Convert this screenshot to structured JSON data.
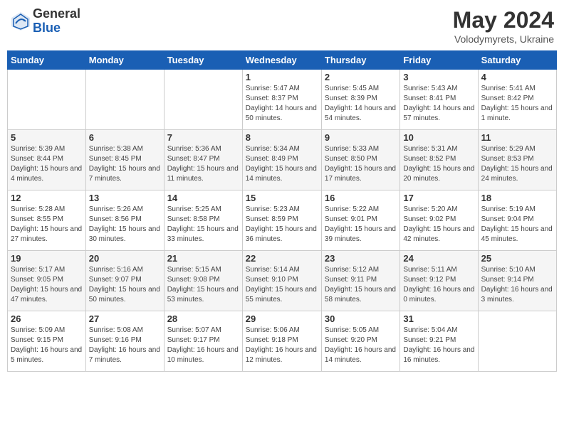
{
  "header": {
    "logo_general": "General",
    "logo_blue": "Blue",
    "month": "May 2024",
    "location": "Volodymyrets, Ukraine"
  },
  "weekdays": [
    "Sunday",
    "Monday",
    "Tuesday",
    "Wednesday",
    "Thursday",
    "Friday",
    "Saturday"
  ],
  "weeks": [
    [
      {
        "day": "",
        "info": ""
      },
      {
        "day": "",
        "info": ""
      },
      {
        "day": "",
        "info": ""
      },
      {
        "day": "1",
        "info": "Sunrise: 5:47 AM\nSunset: 8:37 PM\nDaylight: 14 hours\nand 50 minutes."
      },
      {
        "day": "2",
        "info": "Sunrise: 5:45 AM\nSunset: 8:39 PM\nDaylight: 14 hours\nand 54 minutes."
      },
      {
        "day": "3",
        "info": "Sunrise: 5:43 AM\nSunset: 8:41 PM\nDaylight: 14 hours\nand 57 minutes."
      },
      {
        "day": "4",
        "info": "Sunrise: 5:41 AM\nSunset: 8:42 PM\nDaylight: 15 hours\nand 1 minute."
      }
    ],
    [
      {
        "day": "5",
        "info": "Sunrise: 5:39 AM\nSunset: 8:44 PM\nDaylight: 15 hours\nand 4 minutes."
      },
      {
        "day": "6",
        "info": "Sunrise: 5:38 AM\nSunset: 8:45 PM\nDaylight: 15 hours\nand 7 minutes."
      },
      {
        "day": "7",
        "info": "Sunrise: 5:36 AM\nSunset: 8:47 PM\nDaylight: 15 hours\nand 11 minutes."
      },
      {
        "day": "8",
        "info": "Sunrise: 5:34 AM\nSunset: 8:49 PM\nDaylight: 15 hours\nand 14 minutes."
      },
      {
        "day": "9",
        "info": "Sunrise: 5:33 AM\nSunset: 8:50 PM\nDaylight: 15 hours\nand 17 minutes."
      },
      {
        "day": "10",
        "info": "Sunrise: 5:31 AM\nSunset: 8:52 PM\nDaylight: 15 hours\nand 20 minutes."
      },
      {
        "day": "11",
        "info": "Sunrise: 5:29 AM\nSunset: 8:53 PM\nDaylight: 15 hours\nand 24 minutes."
      }
    ],
    [
      {
        "day": "12",
        "info": "Sunrise: 5:28 AM\nSunset: 8:55 PM\nDaylight: 15 hours\nand 27 minutes."
      },
      {
        "day": "13",
        "info": "Sunrise: 5:26 AM\nSunset: 8:56 PM\nDaylight: 15 hours\nand 30 minutes."
      },
      {
        "day": "14",
        "info": "Sunrise: 5:25 AM\nSunset: 8:58 PM\nDaylight: 15 hours\nand 33 minutes."
      },
      {
        "day": "15",
        "info": "Sunrise: 5:23 AM\nSunset: 8:59 PM\nDaylight: 15 hours\nand 36 minutes."
      },
      {
        "day": "16",
        "info": "Sunrise: 5:22 AM\nSunset: 9:01 PM\nDaylight: 15 hours\nand 39 minutes."
      },
      {
        "day": "17",
        "info": "Sunrise: 5:20 AM\nSunset: 9:02 PM\nDaylight: 15 hours\nand 42 minutes."
      },
      {
        "day": "18",
        "info": "Sunrise: 5:19 AM\nSunset: 9:04 PM\nDaylight: 15 hours\nand 45 minutes."
      }
    ],
    [
      {
        "day": "19",
        "info": "Sunrise: 5:17 AM\nSunset: 9:05 PM\nDaylight: 15 hours\nand 47 minutes."
      },
      {
        "day": "20",
        "info": "Sunrise: 5:16 AM\nSunset: 9:07 PM\nDaylight: 15 hours\nand 50 minutes."
      },
      {
        "day": "21",
        "info": "Sunrise: 5:15 AM\nSunset: 9:08 PM\nDaylight: 15 hours\nand 53 minutes."
      },
      {
        "day": "22",
        "info": "Sunrise: 5:14 AM\nSunset: 9:10 PM\nDaylight: 15 hours\nand 55 minutes."
      },
      {
        "day": "23",
        "info": "Sunrise: 5:12 AM\nSunset: 9:11 PM\nDaylight: 15 hours\nand 58 minutes."
      },
      {
        "day": "24",
        "info": "Sunrise: 5:11 AM\nSunset: 9:12 PM\nDaylight: 16 hours\nand 0 minutes."
      },
      {
        "day": "25",
        "info": "Sunrise: 5:10 AM\nSunset: 9:14 PM\nDaylight: 16 hours\nand 3 minutes."
      }
    ],
    [
      {
        "day": "26",
        "info": "Sunrise: 5:09 AM\nSunset: 9:15 PM\nDaylight: 16 hours\nand 5 minutes."
      },
      {
        "day": "27",
        "info": "Sunrise: 5:08 AM\nSunset: 9:16 PM\nDaylight: 16 hours\nand 7 minutes."
      },
      {
        "day": "28",
        "info": "Sunrise: 5:07 AM\nSunset: 9:17 PM\nDaylight: 16 hours\nand 10 minutes."
      },
      {
        "day": "29",
        "info": "Sunrise: 5:06 AM\nSunset: 9:18 PM\nDaylight: 16 hours\nand 12 minutes."
      },
      {
        "day": "30",
        "info": "Sunrise: 5:05 AM\nSunset: 9:20 PM\nDaylight: 16 hours\nand 14 minutes."
      },
      {
        "day": "31",
        "info": "Sunrise: 5:04 AM\nSunset: 9:21 PM\nDaylight: 16 hours\nand 16 minutes."
      },
      {
        "day": "",
        "info": ""
      }
    ]
  ]
}
